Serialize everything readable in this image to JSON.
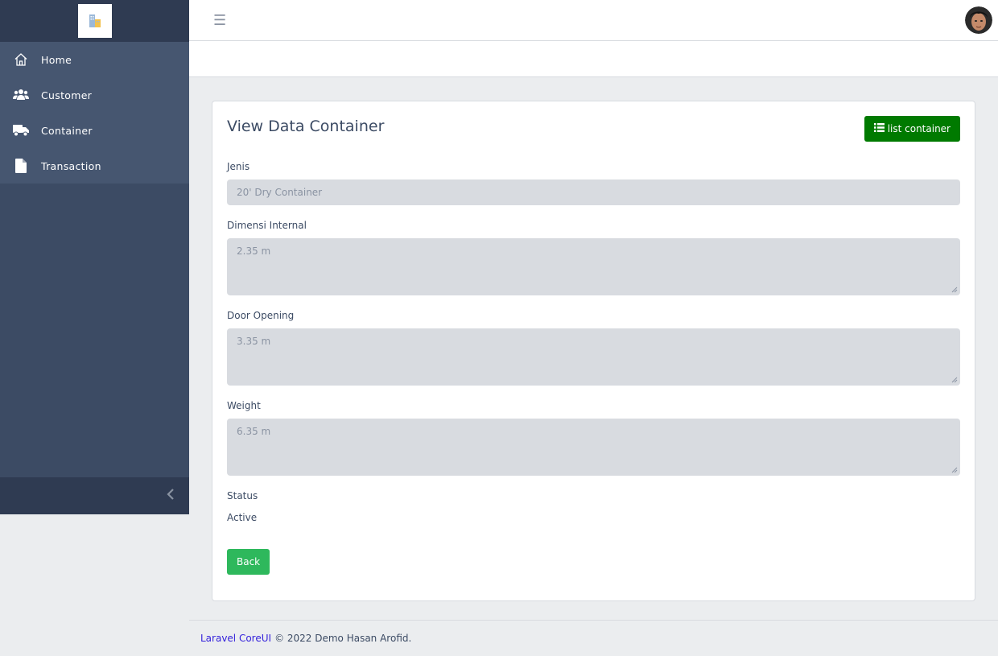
{
  "sidebar": {
    "brand_icon": "building-logo-icon",
    "items": [
      {
        "label": "Home",
        "icon": "home-icon"
      },
      {
        "label": "Customer",
        "icon": "users-icon"
      },
      {
        "label": "Container",
        "icon": "truck-icon"
      },
      {
        "label": "Transaction",
        "icon": "file-icon"
      }
    ],
    "toggler_icon": "chevron-left-icon"
  },
  "header": {
    "menu_icon": "hamburger-icon",
    "avatar": "user-avatar"
  },
  "card": {
    "title": "View Data Container",
    "list_button_label": "list container",
    "fields": {
      "jenis": {
        "label": "Jenis",
        "value": "20' Dry Container"
      },
      "dimensi": {
        "label": "Dimensi Internal",
        "value": "2.35 m"
      },
      "door": {
        "label": "Door Opening",
        "value": "3.35 m"
      },
      "weight": {
        "label": "Weight",
        "value": "6.35 m"
      },
      "status": {
        "label": "Status",
        "value": "Active"
      }
    },
    "back_button_label": "Back"
  },
  "footer": {
    "link_text": "Laravel CoreUI",
    "text": "© 2022 Demo Hasan Arofid."
  },
  "colors": {
    "sidebar": "#3c4b64",
    "list_button": "#007a00",
    "back_button": "#2eb85c",
    "link": "#321fdb"
  }
}
